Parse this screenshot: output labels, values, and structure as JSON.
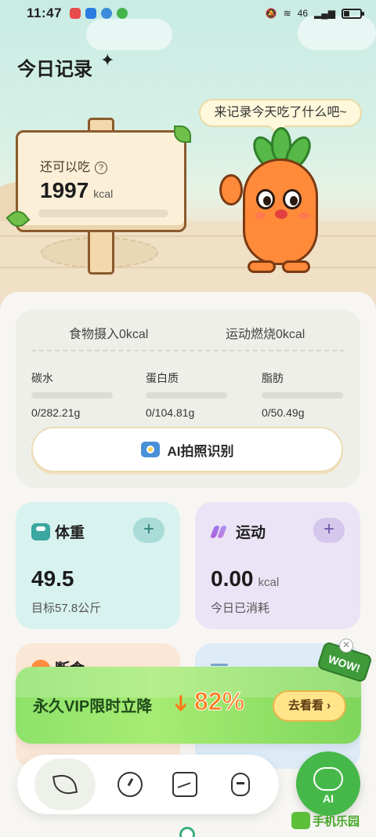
{
  "status_bar": {
    "time": "11:47",
    "right_text": "46"
  },
  "header": {
    "title": "今日记录",
    "sparkle": "✦"
  },
  "signboard": {
    "label": "还可以吃",
    "help": "?",
    "kcal_value": "1997",
    "kcal_unit": "kcal"
  },
  "speech_bubble": {
    "text": "来记录今天吃了什么吧~"
  },
  "summary": {
    "intake": "食物摄入0kcal",
    "burned": "运动燃烧0kcal",
    "macros": [
      {
        "name": "碳水",
        "value": "0/282.21g",
        "progress": 0
      },
      {
        "name": "蛋白质",
        "value": "0/104.81g",
        "progress": 0
      },
      {
        "name": "脂肪",
        "value": "0/50.49g",
        "progress": 0
      }
    ],
    "ai_button": "AI拍照识别"
  },
  "weight_tile": {
    "title": "体重",
    "plus": "+",
    "value": "49.5",
    "sub": "目标57.8公斤"
  },
  "sport_tile": {
    "title": "运动",
    "plus": "+",
    "value": "0.00",
    "unit": "kcal",
    "sub": "今日已消耗"
  },
  "diet_tile": {
    "title": "断食"
  },
  "promo": {
    "text": "永久VIP限时立降",
    "arrow": "➔",
    "percent": "82%",
    "button": "去看看 ›",
    "badge": "WOW!",
    "close": "✕"
  },
  "nav": {
    "items": [
      "leaf-icon",
      "alarm-clock-icon",
      "photo-icon",
      "carrot-icon"
    ]
  },
  "ai_fab": {
    "label": "AI"
  },
  "watermark": {
    "text": "手机乐园"
  },
  "colors": {
    "accent_green": "#46b84a",
    "promo_orange": "#ff7a18",
    "weight_tile": "#d8f2ef",
    "sport_tile": "#ebe4f6"
  }
}
